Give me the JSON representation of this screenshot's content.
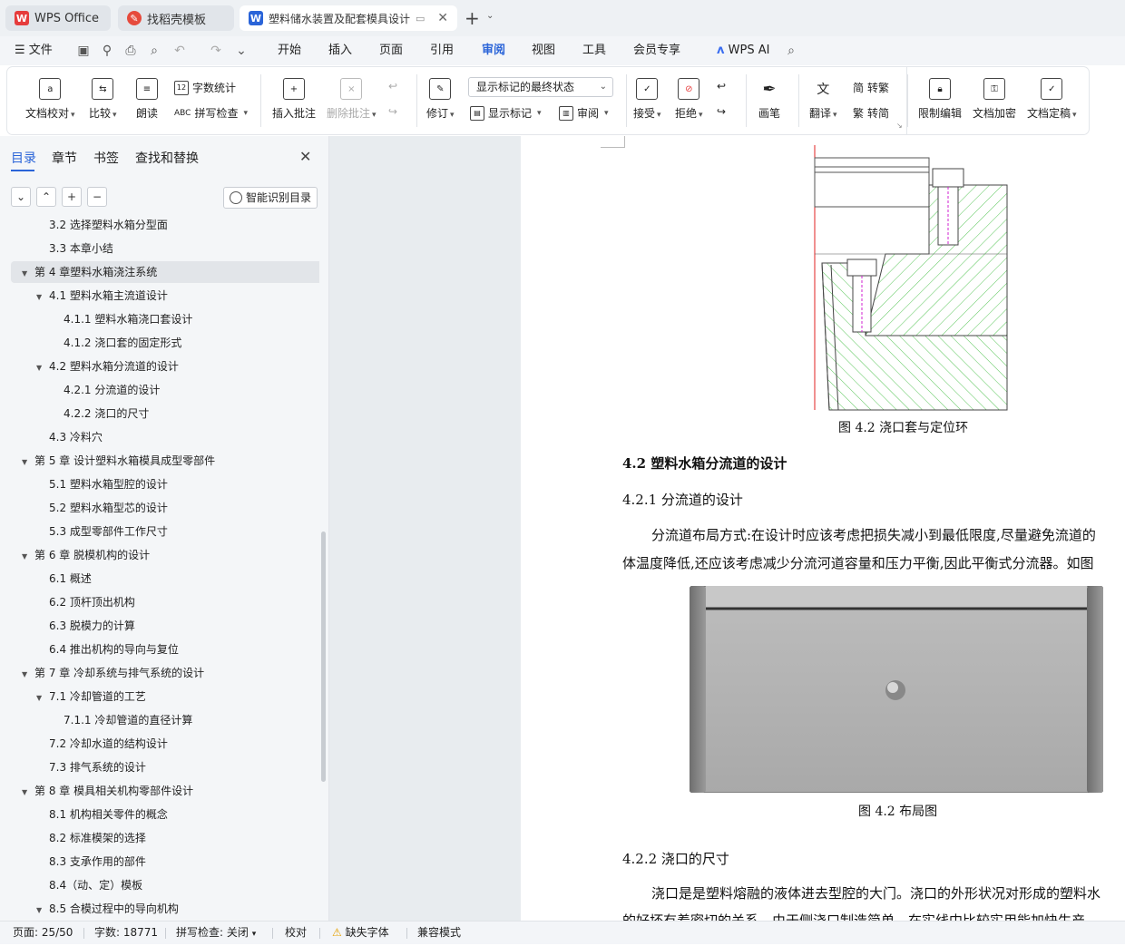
{
  "tabs": [
    {
      "label": "WPS Office"
    },
    {
      "label": "找稻壳模板"
    },
    {
      "label": "塑料储水装置及配套模具设计"
    }
  ],
  "menu": [
    "文件",
    "开始",
    "插入",
    "页面",
    "引用",
    "审阅",
    "视图",
    "工具",
    "会员专享",
    "WPS AI"
  ],
  "ribbon": {
    "doc_check": "文档校对",
    "compare": "比较",
    "read_aloud": "朗读",
    "word_count": "字数统计",
    "spell_check": "拼写检查",
    "insert_comment": "插入批注",
    "delete_comment": "删除批注",
    "revise": "修订",
    "markup_state": "显示标记的最终状态",
    "show_markup": "显示标记",
    "review": "审阅",
    "accept": "接受",
    "reject": "拒绝",
    "draw": "画笔",
    "translate": "翻译",
    "simp_to_trad": "转繁",
    "trad_to_simp": "转简",
    "restrict_edit": "限制编辑",
    "encrypt": "文档加密",
    "finalize": "文档定稿"
  },
  "nav": {
    "tabs": [
      "目录",
      "章节",
      "书签",
      "查找和替换"
    ],
    "smart_toc": "智能识别目录",
    "toc": [
      {
        "text": "3.2 选择塑料水箱分型面",
        "level": 2,
        "arrow": ""
      },
      {
        "text": "3.3  本章小结",
        "level": 2,
        "arrow": ""
      },
      {
        "text": "第 4 章塑料水箱浇注系统",
        "level": 1,
        "arrow": "▼",
        "selected": true
      },
      {
        "text": "4.1 塑料水箱主流道设计",
        "level": 2,
        "arrow": "▼"
      },
      {
        "text": "4.1.1 塑料水箱浇口套设计",
        "level": 3,
        "arrow": ""
      },
      {
        "text": "4.1.2 浇口套的固定形式",
        "level": 3,
        "arrow": ""
      },
      {
        "text": "4.2 塑料水箱分流道的设计",
        "level": 2,
        "arrow": "▼"
      },
      {
        "text": "4.2.1  分流道的设计",
        "level": 3,
        "arrow": ""
      },
      {
        "text": "4.2.2 浇口的尺寸",
        "level": 3,
        "arrow": ""
      },
      {
        "text": "4.3  冷料穴",
        "level": 2,
        "arrow": ""
      },
      {
        "text": "第 5 章   设计塑料水箱模具成型零部件",
        "level": 1,
        "arrow": "▼"
      },
      {
        "text": "5.1 塑料水箱型腔的设计",
        "level": 2,
        "arrow": ""
      },
      {
        "text": "5.2 塑料水箱型芯的设计",
        "level": 2,
        "arrow": ""
      },
      {
        "text": "5.3 成型零部件工作尺寸",
        "level": 2,
        "arrow": ""
      },
      {
        "text": "第 6 章    脱模机构的设计",
        "level": 1,
        "arrow": "▼"
      },
      {
        "text": "6.1 概述",
        "level": 2,
        "arrow": ""
      },
      {
        "text": "6.2 顶杆顶出机构",
        "level": 2,
        "arrow": ""
      },
      {
        "text": "6.3  脱模力的计算",
        "level": 2,
        "arrow": ""
      },
      {
        "text": "6.4 推出机构的导向与复位",
        "level": 2,
        "arrow": ""
      },
      {
        "text": "第 7 章  冷却系统与排气系统的设计",
        "level": 1,
        "arrow": "▼"
      },
      {
        "text": "7.1  冷却管道的工艺",
        "level": 2,
        "arrow": "▼"
      },
      {
        "text": "7.1.1  冷却管道的直径计算",
        "level": 3,
        "arrow": ""
      },
      {
        "text": "7.2  冷却水道的结构设计",
        "level": 2,
        "arrow": ""
      },
      {
        "text": "7.3  排气系统的设计",
        "level": 2,
        "arrow": ""
      },
      {
        "text": "第 8 章  模具相关机构零部件设计",
        "level": 1,
        "arrow": "▼"
      },
      {
        "text": "8.1 机构相关零件的概念",
        "level": 2,
        "arrow": ""
      },
      {
        "text": "8.2 标准模架的选择",
        "level": 2,
        "arrow": ""
      },
      {
        "text": "8.3 支承作用的部件",
        "level": 2,
        "arrow": ""
      },
      {
        "text": "8.4（动、定）模板",
        "level": 2,
        "arrow": ""
      },
      {
        "text": "8.5 合模过程中的导向机构",
        "level": 2,
        "arrow": "▼"
      }
    ]
  },
  "doc": {
    "fig42_caption": "图 4.2  浇口套与定位环",
    "h_422": "4.2 塑料水箱分流道的设计",
    "h_4221": "4.2.1  分流道的设计",
    "para1_line1": "分流道布局方式:在设计时应该考虑把损失减小到最低限度,尽量避免流道的",
    "para1_line2": "体温度降低,还应该考虑减少分流河道容量和压力平衡,因此平衡式分流器。如图",
    "fig42b_caption": "图 4.2  布局图",
    "h_4222": "4.2.2 浇口的尺寸",
    "para2_line1": "浇口是是塑料熔融的液体进去型腔的大门。浇口的外形状况对形成的塑料水",
    "para2_line2": "的好坏有着密切的关系。由于侧浇口制造简单，在实线中比较实用能加快生产"
  },
  "status": {
    "page": "页面: 25/50",
    "words": "字数: 18771",
    "spell": "拼写检查: 关闭",
    "proof": "校对",
    "missing_font": "缺失字体",
    "compat": "兼容模式"
  },
  "colors": {
    "accent": "#2a64d8",
    "wps_red": "#e63c3c",
    "hatch_green": "#2eb82e"
  }
}
